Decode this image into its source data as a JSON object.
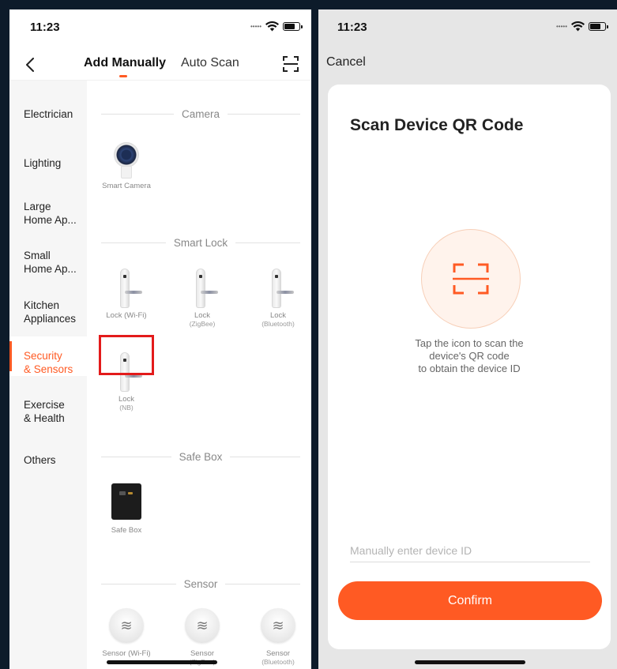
{
  "left": {
    "status": {
      "time": "11:23"
    },
    "tabs": {
      "manual": "Add Manually",
      "auto": "Auto Scan"
    },
    "categories": [
      {
        "label": "Electrician"
      },
      {
        "label": "Lighting"
      },
      {
        "label": "Large\nHome Ap..."
      },
      {
        "label": "Small\nHome Ap..."
      },
      {
        "label": "Kitchen\nAppliances"
      },
      {
        "label": "Security\n& Sensors",
        "active": true
      },
      {
        "label": "Exercise\n& Health"
      },
      {
        "label": "Others"
      }
    ],
    "sections": {
      "camera": "Camera",
      "smart_lock": "Smart Lock",
      "safe_box": "Safe Box",
      "sensor": "Sensor"
    },
    "devices": {
      "smart_camera": "Smart Camera",
      "lock_wifi": "Lock (Wi-Fi)",
      "lock_zigbee": {
        "name": "Lock",
        "sub": "(ZigBee)"
      },
      "lock_bluetooth": {
        "name": "Lock",
        "sub": "(Bluetooth)"
      },
      "lock_nb": {
        "name": "Lock",
        "sub": "(NB)"
      },
      "safe_box": "Safe Box",
      "sensor_wifi": "Sensor (Wi-Fi)",
      "sensor_zigbee": {
        "name": "Sensor",
        "sub": "(ZigBee)"
      },
      "sensor_bluetooth": {
        "name": "Sensor",
        "sub": "(Bluetooth)"
      }
    },
    "colors": {
      "accent": "#ff5a23",
      "highlight": "#e31b1b"
    }
  },
  "right": {
    "status": {
      "time": "11:23"
    },
    "cancel_label": "Cancel",
    "title": "Scan Device QR Code",
    "hint": [
      "Tap the icon to scan the",
      "device's QR code",
      "to obtain the device ID"
    ],
    "input_placeholder": "Manually enter device ID",
    "confirm_label": "Confirm"
  }
}
